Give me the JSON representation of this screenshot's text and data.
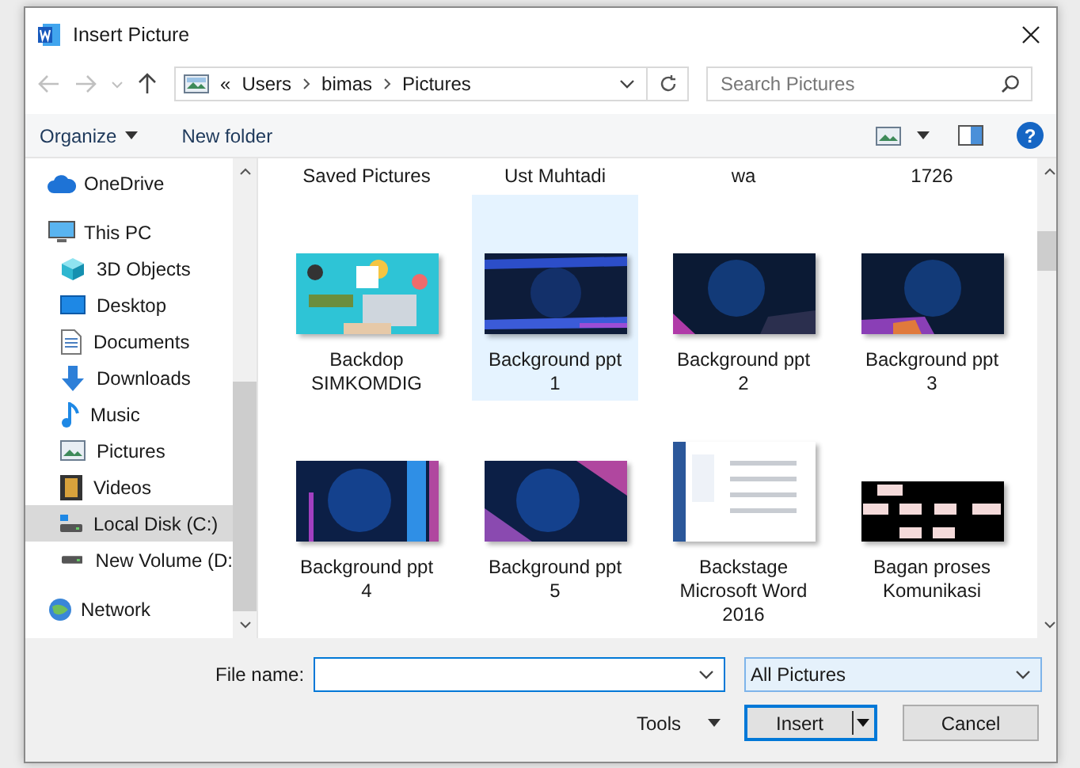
{
  "window": {
    "title": "Insert Picture"
  },
  "address": {
    "overflow": "«",
    "path": [
      "Users",
      "bimas",
      "Pictures"
    ]
  },
  "search": {
    "placeholder": "Search Pictures"
  },
  "toolbar": {
    "organize": "Organize",
    "new_folder": "New folder",
    "help": "?"
  },
  "sidebar": {
    "items": [
      {
        "label": "OneDrive",
        "selected": false
      },
      {
        "label": "This PC",
        "selected": false,
        "children": [
          {
            "label": "3D Objects",
            "selected": false
          },
          {
            "label": "Desktop",
            "selected": false
          },
          {
            "label": "Documents",
            "selected": false
          },
          {
            "label": "Downloads",
            "selected": false
          },
          {
            "label": "Music",
            "selected": false
          },
          {
            "label": "Pictures",
            "selected": false
          },
          {
            "label": "Videos",
            "selected": false
          },
          {
            "label": "Local Disk (C:)",
            "selected": true
          },
          {
            "label": "New Volume (D:",
            "selected": false
          }
        ]
      },
      {
        "label": "Network",
        "selected": false
      }
    ]
  },
  "files": [
    {
      "name": "Saved Pictures",
      "kind": "folder",
      "selected": false
    },
    {
      "name": "Ust Muhtadi",
      "kind": "folder",
      "selected": false
    },
    {
      "name": "wa",
      "kind": "folder",
      "selected": false
    },
    {
      "name": "1726",
      "kind": "folder",
      "selected": false
    },
    {
      "name": "Backdop SIMKOMDIG",
      "kind": "picture",
      "selected": false
    },
    {
      "name": "Background ppt 1",
      "kind": "picture",
      "selected": true
    },
    {
      "name": "Background ppt 2",
      "kind": "picture",
      "selected": false
    },
    {
      "name": "Background ppt 3",
      "kind": "picture",
      "selected": false
    },
    {
      "name": "Background ppt 4",
      "kind": "picture",
      "selected": false
    },
    {
      "name": "Background ppt 5",
      "kind": "picture",
      "selected": false
    },
    {
      "name": "Backstage Microsoft Word 2016",
      "kind": "picture",
      "selected": false
    },
    {
      "name": "Bagan proses Komunikasi",
      "kind": "picture",
      "selected": false
    }
  ],
  "bottom": {
    "file_name_label": "File name:",
    "filter": "All Pictures",
    "tools": "Tools",
    "insert": "Insert",
    "cancel": "Cancel"
  }
}
